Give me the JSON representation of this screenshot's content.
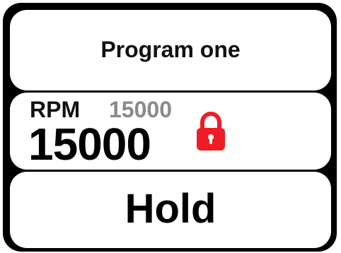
{
  "program": {
    "name": "Program one"
  },
  "rpm": {
    "label": "RPM",
    "setpoint": "15000",
    "current": "15000",
    "locked": true,
    "lock_color": "#ee1c25"
  },
  "mode": {
    "label": "Hold"
  },
  "icons": {
    "lock": "lock-icon"
  }
}
